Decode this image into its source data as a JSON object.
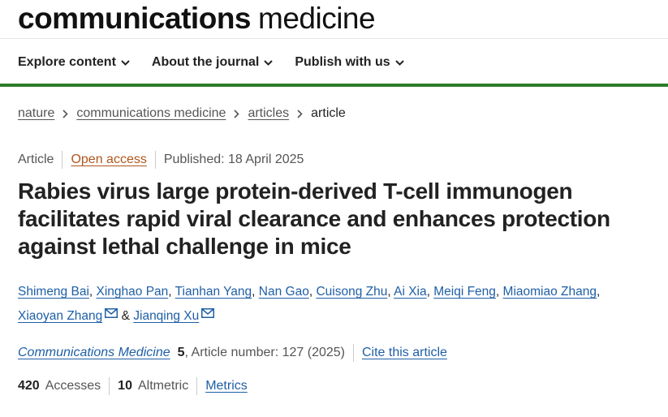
{
  "brand": {
    "bold": "communications",
    "light": "medicine"
  },
  "nav": {
    "items": [
      {
        "label": "Explore content",
        "icon": "chevron-down-icon"
      },
      {
        "label": "About the journal",
        "icon": "chevron-down-icon"
      },
      {
        "label": "Publish with us",
        "icon": "chevron-down-icon"
      }
    ]
  },
  "breadcrumb": {
    "items": [
      "nature",
      "communications medicine",
      "articles"
    ],
    "current": "article",
    "separator_icon": "chevron-right-icon"
  },
  "meta": {
    "type": "Article",
    "access": "Open access",
    "published": "Published: 18 April 2025"
  },
  "title": "Rabies virus large protein-derived T-cell immunogen facilitates rapid viral clearance and enhances protection against lethal challenge in mice",
  "authors": {
    "list": [
      "Shimeng Bai",
      "Xinghao Pan",
      "Tianhan Yang",
      "Nan Gao",
      "Cuisong Zhu",
      "Ai Xia",
      "Meiqi Feng",
      "Miaomiao Zhang",
      "Xiaoyan Zhang",
      "Jianqing Xu"
    ],
    "separator": ",",
    "conjunction": "&",
    "contact_icon": "mail-icon"
  },
  "citation": {
    "journal": "Communications Medicine",
    "volume": "5",
    "article_number": ", Article number: 127 (2025)",
    "cite_label": "Cite this article"
  },
  "metrics": {
    "accesses_count": "420",
    "accesses_label": "Accesses",
    "altmetric_count": "10",
    "altmetric_label": "Altmetric",
    "metrics_label": "Metrics"
  },
  "colors": {
    "accent_green": "#2c7d2a",
    "link_blue": "#1f5fa6",
    "open_access_orange": "#b0561c"
  }
}
